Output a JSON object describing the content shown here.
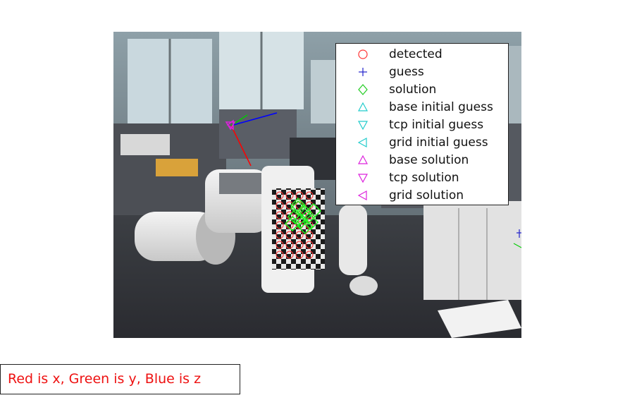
{
  "figure": {
    "legend": {
      "items": [
        {
          "label": "detected",
          "marker": "circle-icon",
          "color": "#ff3333"
        },
        {
          "label": "guess",
          "marker": "plus-icon",
          "color": "#2222cc"
        },
        {
          "label": "solution",
          "marker": "diamond-icon",
          "color": "#22cc22"
        },
        {
          "label": "base initial guess",
          "marker": "triangle-up-icon",
          "color": "#22cccc"
        },
        {
          "label": "tcp initial guess",
          "marker": "triangle-down-icon",
          "color": "#22cccc"
        },
        {
          "label": "grid initial guess",
          "marker": "triangle-left-icon",
          "color": "#22cccc"
        },
        {
          "label": "base solution",
          "marker": "triangle-up-icon",
          "color": "#dd22dd"
        },
        {
          "label": "tcp solution",
          "marker": "triangle-down-icon",
          "color": "#dd22dd"
        },
        {
          "label": "grid solution",
          "marker": "triangle-left-icon",
          "color": "#dd22dd"
        }
      ]
    },
    "caption": {
      "text": "Red is x, Green is y, Blue is z",
      "color": "#ee1111"
    },
    "axis_colors": {
      "x": "#ff0000",
      "y": "#00cc00",
      "z": "#0000ff"
    }
  }
}
